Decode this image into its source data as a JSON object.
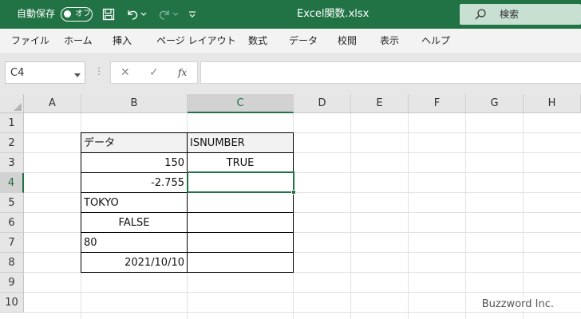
{
  "titlebar": {
    "autosave_label": "自動保存",
    "autosave_state": "オフ",
    "document_title": "Excel関数.xlsx",
    "search_placeholder": "検索"
  },
  "ribbon": {
    "tabs": [
      "ファイル",
      "ホーム",
      "挿入",
      "ページ レイアウト",
      "数式",
      "データ",
      "校閲",
      "表示",
      "ヘルプ"
    ]
  },
  "formula_bar": {
    "name_box": "C4",
    "fx_label": "fx",
    "formula": ""
  },
  "sheet": {
    "columns": [
      "A",
      "B",
      "C",
      "D",
      "E",
      "F",
      "G",
      "H"
    ],
    "rows": [
      "1",
      "2",
      "3",
      "4",
      "5",
      "6",
      "7",
      "8",
      "9",
      "10"
    ],
    "selected_cell": "C4",
    "cells": {
      "B2": "データ",
      "C2": "ISNUMBER",
      "B3": "150",
      "C3": "TRUE",
      "B4": "-2.755",
      "C4": "",
      "B5": "TOKYO",
      "B6": "FALSE",
      "B7": "80",
      "B8": "2021/10/10"
    }
  },
  "watermark": "Buzzword Inc.",
  "colors": {
    "accent": "#217346",
    "header_bg": "#e6e6e6",
    "selected_header_bg": "#d2d2d2"
  }
}
